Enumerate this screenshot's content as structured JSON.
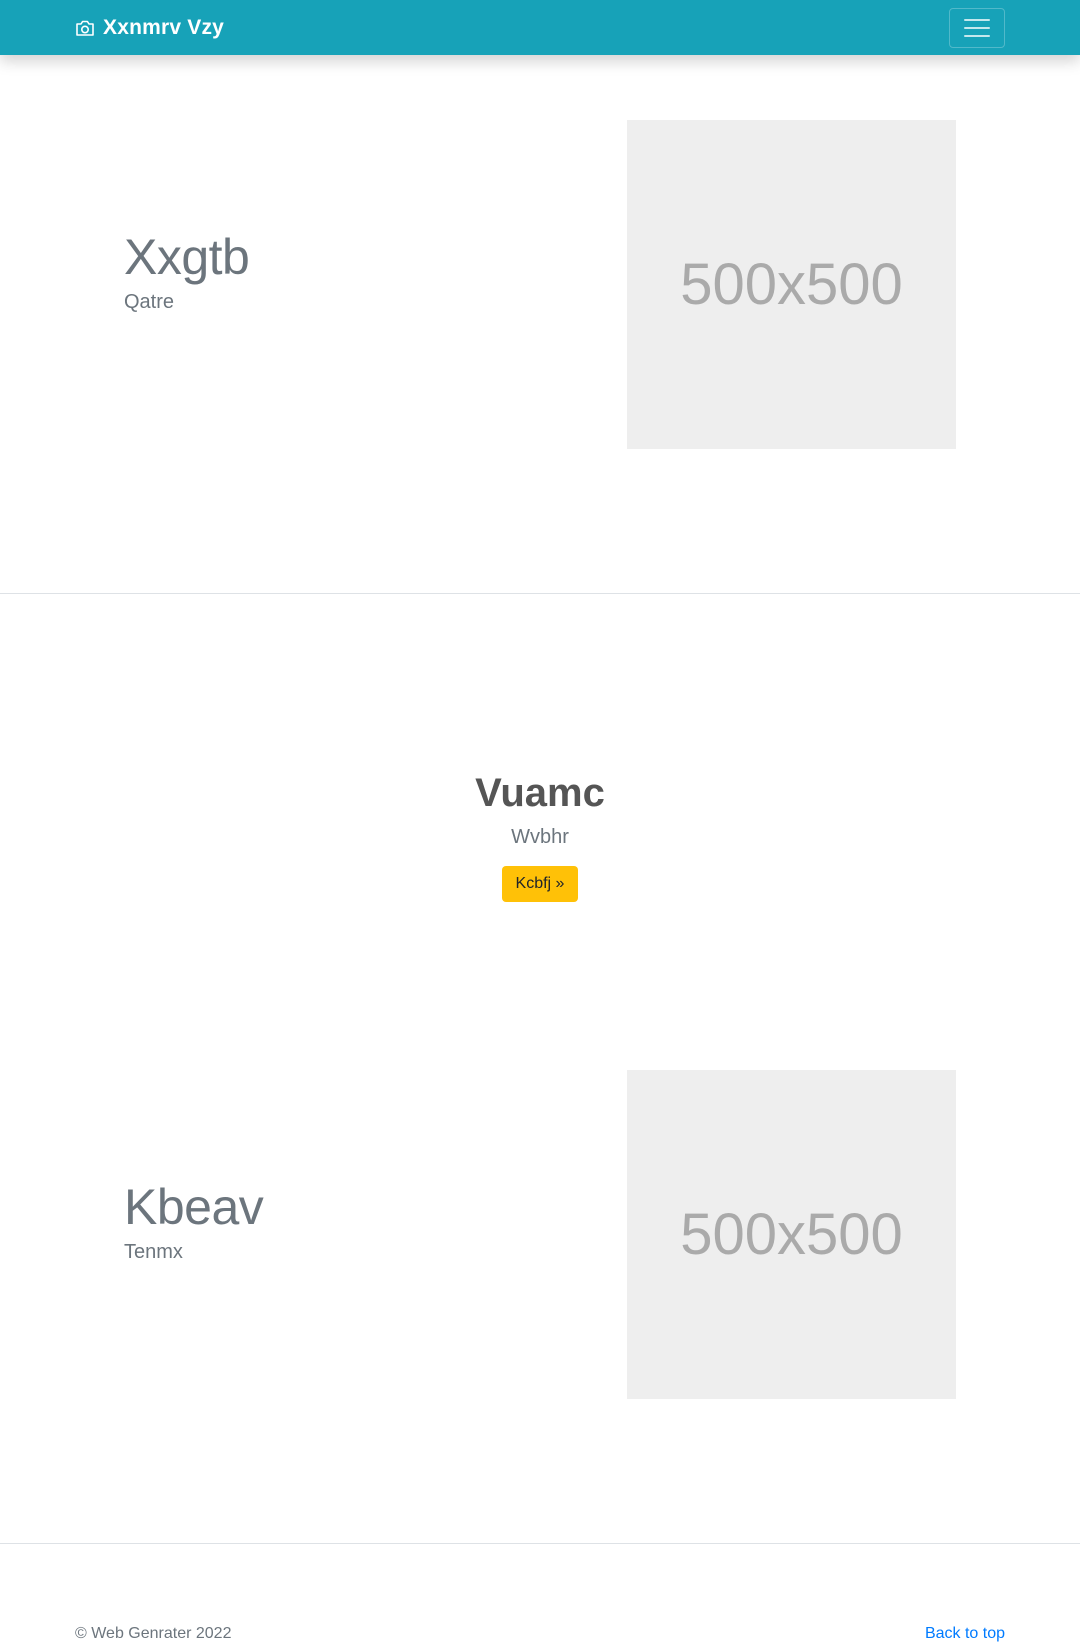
{
  "navbar": {
    "brand": "Xxnmrv Vzy",
    "brand_icon": "camera-icon",
    "toggler_icon": "hamburger-icon",
    "background_color": "#17a2b8"
  },
  "feature_one": {
    "heading": "Xxgtb",
    "lead": "Qatre",
    "image_label": "500x500"
  },
  "cta": {
    "title": "Vuamc",
    "subtitle": "Wvbhr",
    "button_label": "Kcbfj »",
    "button_color": "#ffc107"
  },
  "feature_two": {
    "heading": "Kbeav",
    "lead": "Tenmx",
    "image_label": "500x500"
  },
  "footer": {
    "copyright": "© Web Genrater 2022",
    "back_to_top": "Back to top"
  }
}
